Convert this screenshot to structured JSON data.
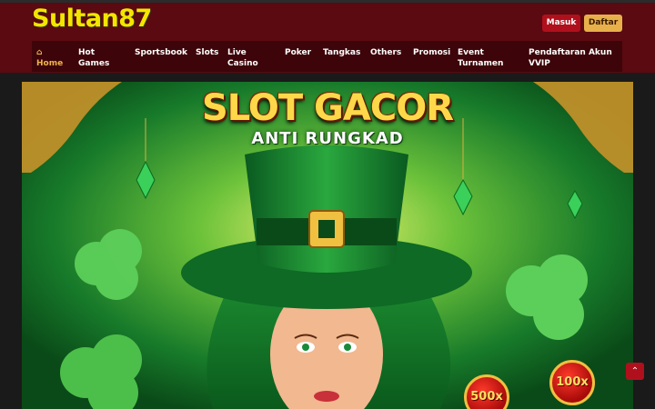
{
  "header": {
    "logo_text": "Sultan87",
    "login_label": "Masuk",
    "register_label": "Daftar"
  },
  "nav": {
    "items": [
      {
        "label": "Home",
        "icon": "home-icon",
        "active": true
      },
      {
        "label": "Hot\nGames"
      },
      {
        "label": "Sportsbook"
      },
      {
        "label": "Slots"
      },
      {
        "label": "Live\nCasino"
      },
      {
        "label": "Poker"
      },
      {
        "label": "Tangkas"
      },
      {
        "label": "Others"
      },
      {
        "label": "Promosi"
      },
      {
        "label": "Event\nTurnamen"
      },
      {
        "label": "Pendaftaran Akun\nVVIP"
      }
    ]
  },
  "banner": {
    "title": "SLOT GACOR",
    "subtitle": "ANTI RUNGKAD",
    "chips": [
      "500x",
      "100x"
    ]
  },
  "scroll_top_icon": "chevron-up-icon",
  "colors": {
    "header_bg": "#5a0a10",
    "nav_bg": "#3d0509",
    "logo": "#f2e600",
    "accent_gold": "#f0b44a",
    "login_btn": "#b0101c",
    "register_btn": "#e8b04a"
  }
}
